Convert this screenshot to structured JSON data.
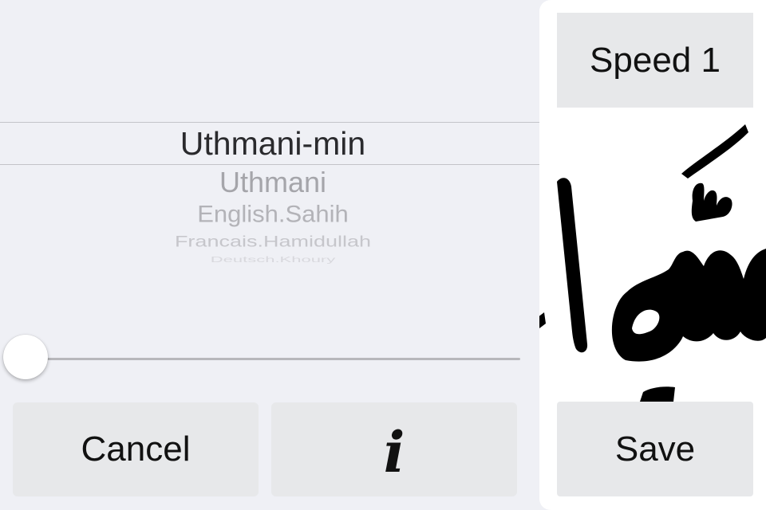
{
  "picker": {
    "selected": "Uthmani-min",
    "options": [
      "Uthmani",
      "English.Sahih",
      "Francais.Hamidullah",
      "Deutsch.Khoury"
    ]
  },
  "slider": {
    "value": 0
  },
  "buttons": {
    "cancel_label": "Cancel",
    "info_label": "i",
    "speed_label": "Speed 1",
    "save_label": "Save"
  },
  "preview": {
    "text": "الله",
    "icon": "allah-calligraphy"
  },
  "colors": {
    "background": "#eff0f5",
    "button": "#e7e8ea",
    "panel": "#ffffff",
    "text": "#111111"
  }
}
